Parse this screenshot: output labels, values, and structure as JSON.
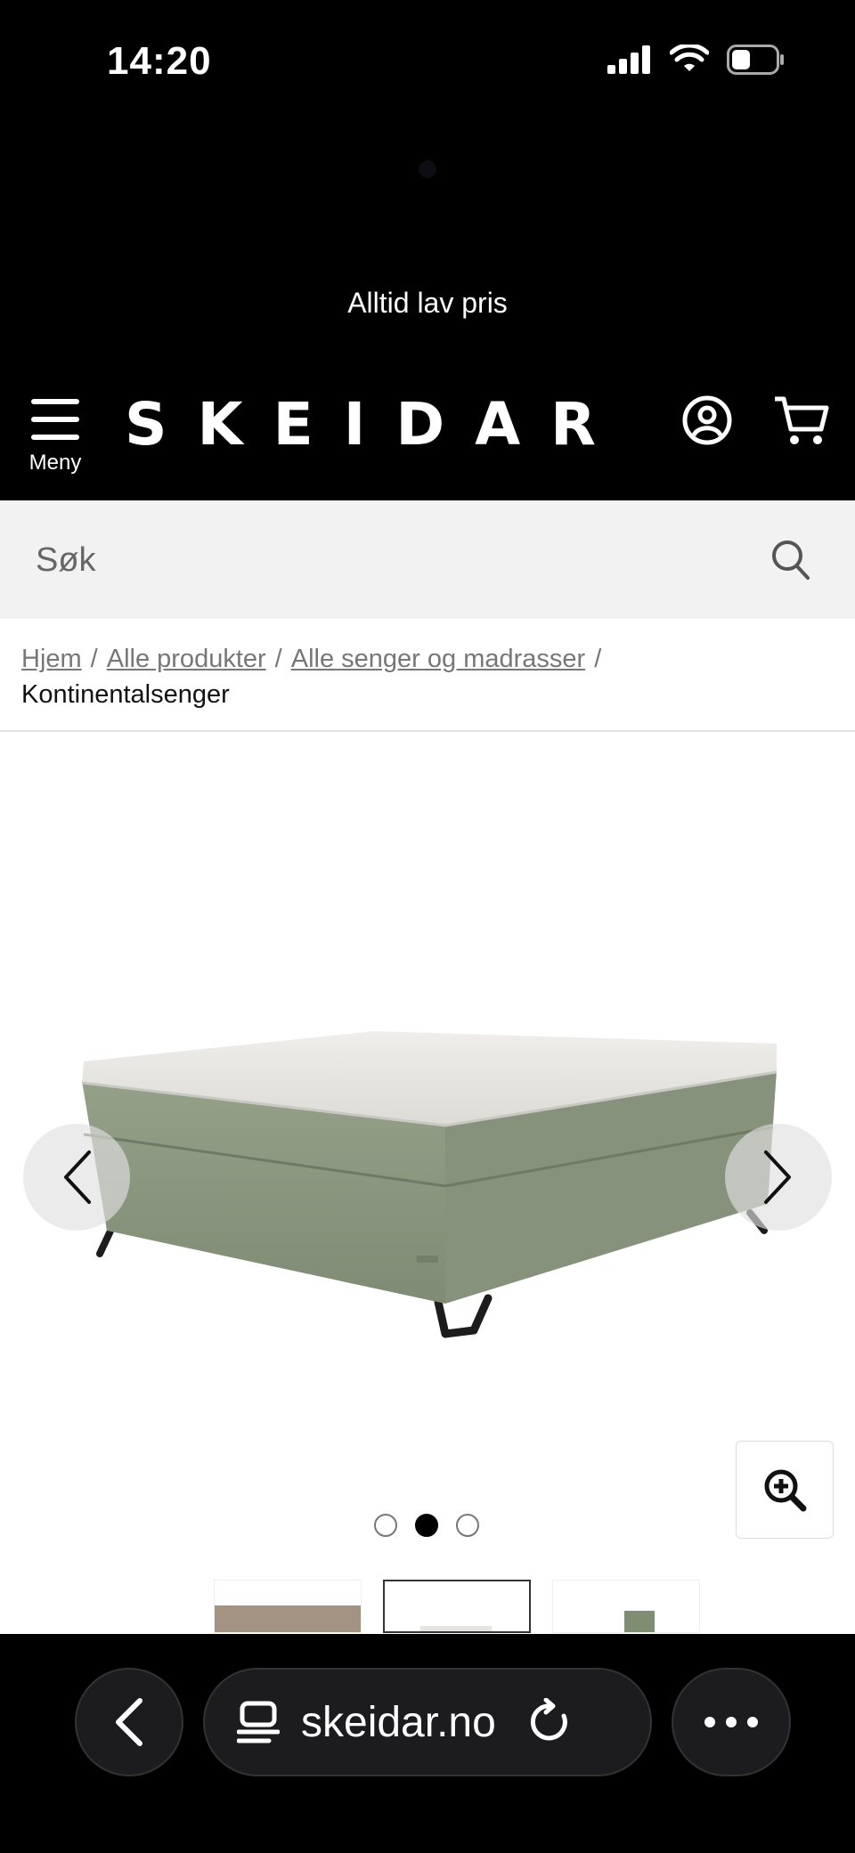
{
  "status_bar": {
    "time": "14:20"
  },
  "promo": {
    "text": "Alltid lav pris"
  },
  "header": {
    "logo": "SKEIDAR",
    "menu_label": "Meny"
  },
  "search": {
    "placeholder": "Søk"
  },
  "breadcrumb": {
    "links": [
      "Hjem",
      "Alle produkter",
      "Alle senger og madrasser"
    ],
    "separator": "/",
    "current": "Kontinentalsenger"
  },
  "gallery": {
    "active_slide": 2,
    "slide_count": 3,
    "product_colors": {
      "base": "#8e9a82",
      "mattress": "#ecebe7",
      "legs": "#1c1c1c"
    }
  },
  "browser": {
    "url": "skeidar.no"
  }
}
